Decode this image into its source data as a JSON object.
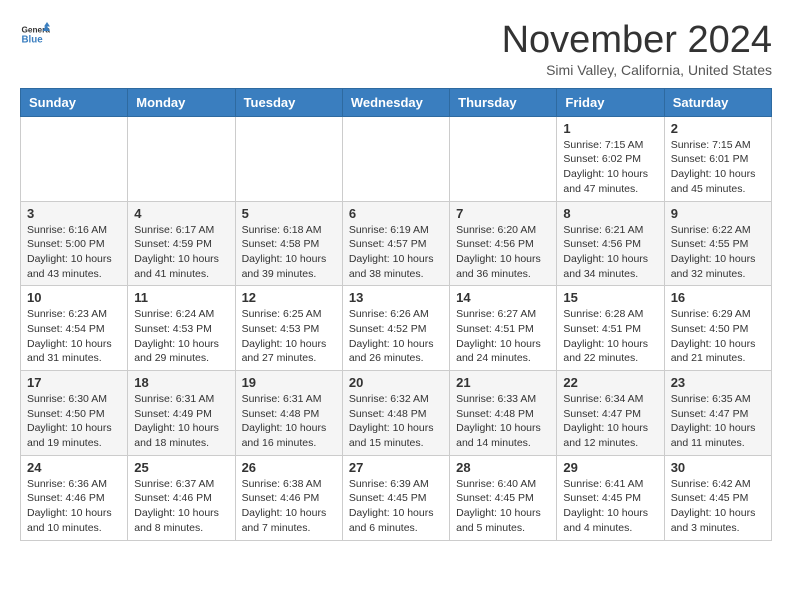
{
  "header": {
    "logo_line1": "General",
    "logo_line2": "Blue",
    "month": "November 2024",
    "location": "Simi Valley, California, United States"
  },
  "weekdays": [
    "Sunday",
    "Monday",
    "Tuesday",
    "Wednesday",
    "Thursday",
    "Friday",
    "Saturday"
  ],
  "weeks": [
    [
      {
        "day": "",
        "info": ""
      },
      {
        "day": "",
        "info": ""
      },
      {
        "day": "",
        "info": ""
      },
      {
        "day": "",
        "info": ""
      },
      {
        "day": "",
        "info": ""
      },
      {
        "day": "1",
        "info": "Sunrise: 7:15 AM\nSunset: 6:02 PM\nDaylight: 10 hours and 47 minutes."
      },
      {
        "day": "2",
        "info": "Sunrise: 7:15 AM\nSunset: 6:01 PM\nDaylight: 10 hours and 45 minutes."
      }
    ],
    [
      {
        "day": "3",
        "info": "Sunrise: 6:16 AM\nSunset: 5:00 PM\nDaylight: 10 hours and 43 minutes."
      },
      {
        "day": "4",
        "info": "Sunrise: 6:17 AM\nSunset: 4:59 PM\nDaylight: 10 hours and 41 minutes."
      },
      {
        "day": "5",
        "info": "Sunrise: 6:18 AM\nSunset: 4:58 PM\nDaylight: 10 hours and 39 minutes."
      },
      {
        "day": "6",
        "info": "Sunrise: 6:19 AM\nSunset: 4:57 PM\nDaylight: 10 hours and 38 minutes."
      },
      {
        "day": "7",
        "info": "Sunrise: 6:20 AM\nSunset: 4:56 PM\nDaylight: 10 hours and 36 minutes."
      },
      {
        "day": "8",
        "info": "Sunrise: 6:21 AM\nSunset: 4:56 PM\nDaylight: 10 hours and 34 minutes."
      },
      {
        "day": "9",
        "info": "Sunrise: 6:22 AM\nSunset: 4:55 PM\nDaylight: 10 hours and 32 minutes."
      }
    ],
    [
      {
        "day": "10",
        "info": "Sunrise: 6:23 AM\nSunset: 4:54 PM\nDaylight: 10 hours and 31 minutes."
      },
      {
        "day": "11",
        "info": "Sunrise: 6:24 AM\nSunset: 4:53 PM\nDaylight: 10 hours and 29 minutes."
      },
      {
        "day": "12",
        "info": "Sunrise: 6:25 AM\nSunset: 4:53 PM\nDaylight: 10 hours and 27 minutes."
      },
      {
        "day": "13",
        "info": "Sunrise: 6:26 AM\nSunset: 4:52 PM\nDaylight: 10 hours and 26 minutes."
      },
      {
        "day": "14",
        "info": "Sunrise: 6:27 AM\nSunset: 4:51 PM\nDaylight: 10 hours and 24 minutes."
      },
      {
        "day": "15",
        "info": "Sunrise: 6:28 AM\nSunset: 4:51 PM\nDaylight: 10 hours and 22 minutes."
      },
      {
        "day": "16",
        "info": "Sunrise: 6:29 AM\nSunset: 4:50 PM\nDaylight: 10 hours and 21 minutes."
      }
    ],
    [
      {
        "day": "17",
        "info": "Sunrise: 6:30 AM\nSunset: 4:50 PM\nDaylight: 10 hours and 19 minutes."
      },
      {
        "day": "18",
        "info": "Sunrise: 6:31 AM\nSunset: 4:49 PM\nDaylight: 10 hours and 18 minutes."
      },
      {
        "day": "19",
        "info": "Sunrise: 6:31 AM\nSunset: 4:48 PM\nDaylight: 10 hours and 16 minutes."
      },
      {
        "day": "20",
        "info": "Sunrise: 6:32 AM\nSunset: 4:48 PM\nDaylight: 10 hours and 15 minutes."
      },
      {
        "day": "21",
        "info": "Sunrise: 6:33 AM\nSunset: 4:48 PM\nDaylight: 10 hours and 14 minutes."
      },
      {
        "day": "22",
        "info": "Sunrise: 6:34 AM\nSunset: 4:47 PM\nDaylight: 10 hours and 12 minutes."
      },
      {
        "day": "23",
        "info": "Sunrise: 6:35 AM\nSunset: 4:47 PM\nDaylight: 10 hours and 11 minutes."
      }
    ],
    [
      {
        "day": "24",
        "info": "Sunrise: 6:36 AM\nSunset: 4:46 PM\nDaylight: 10 hours and 10 minutes."
      },
      {
        "day": "25",
        "info": "Sunrise: 6:37 AM\nSunset: 4:46 PM\nDaylight: 10 hours and 8 minutes."
      },
      {
        "day": "26",
        "info": "Sunrise: 6:38 AM\nSunset: 4:46 PM\nDaylight: 10 hours and 7 minutes."
      },
      {
        "day": "27",
        "info": "Sunrise: 6:39 AM\nSunset: 4:45 PM\nDaylight: 10 hours and 6 minutes."
      },
      {
        "day": "28",
        "info": "Sunrise: 6:40 AM\nSunset: 4:45 PM\nDaylight: 10 hours and 5 minutes."
      },
      {
        "day": "29",
        "info": "Sunrise: 6:41 AM\nSunset: 4:45 PM\nDaylight: 10 hours and 4 minutes."
      },
      {
        "day": "30",
        "info": "Sunrise: 6:42 AM\nSunset: 4:45 PM\nDaylight: 10 hours and 3 minutes."
      }
    ]
  ]
}
